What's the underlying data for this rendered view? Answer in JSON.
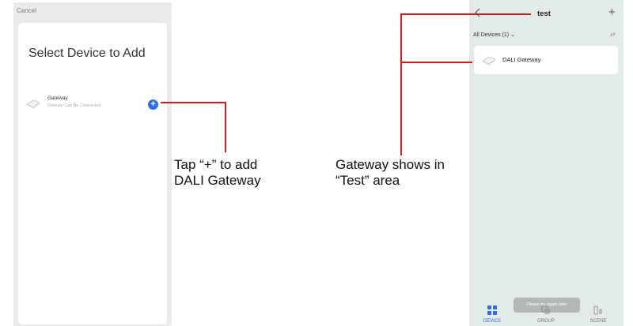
{
  "left_screen": {
    "cancel_label": "Cancel",
    "title": "Select Device to Add",
    "device": {
      "name": "Gateway",
      "subtitle": "Devices Can Be Connected",
      "icon": "gateway-icon",
      "add_button_icon": "+"
    }
  },
  "right_screen": {
    "title": "test",
    "back_icon": "chevron-left-icon",
    "add_icon": "+",
    "filter_label": "All Devices (1) ⌄",
    "sort_icon": "⇄",
    "device_label": "DALI Gateway",
    "nav": [
      {
        "label": "DEVICE",
        "icon": "grid-icon",
        "active": true
      },
      {
        "label": "GROUP",
        "icon": "group-icon",
        "active": false
      },
      {
        "label": "SCENE",
        "icon": "scene-icon",
        "active": false
      }
    ],
    "toast": "Please try again later"
  },
  "callouts": {
    "left_line1": "Tap “+” to add",
    "left_line2": "DALI Gateway",
    "right_line1": "Gateway shows in",
    "right_line2": "“Test” area"
  },
  "colors": {
    "callout_line": "#cc1f1f",
    "accent_blue": "#2f6de0",
    "right_background": "#e2eaea"
  }
}
